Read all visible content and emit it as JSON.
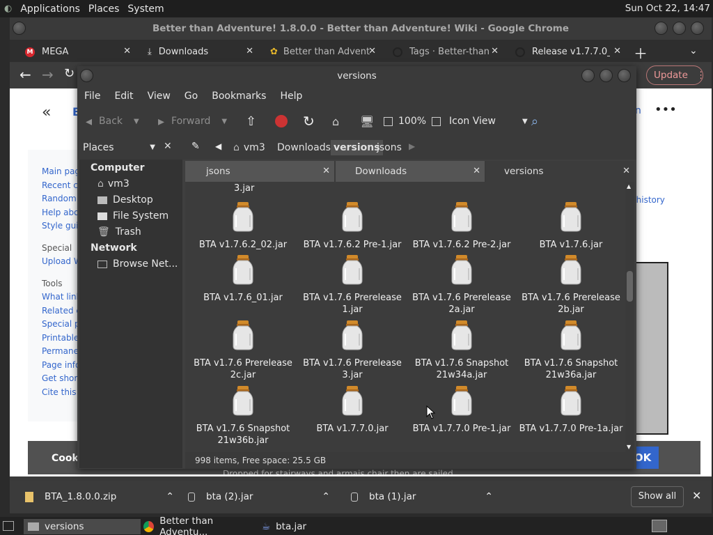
{
  "topbar": {
    "menus": [
      "Applications",
      "Places",
      "System"
    ],
    "clock": "Sun Oct 22, 14:47"
  },
  "chrome": {
    "title": "Better than Adventure! 1.8.0.0 - Better than Adventure! Wiki - Google Chrome",
    "tabs": [
      {
        "label": "MEGA",
        "icon": "mega-icon"
      },
      {
        "label": "Downloads",
        "icon": "download-icon"
      },
      {
        "label": "Better than Advent",
        "icon": "bta-icon"
      },
      {
        "label": "Tags · Better-than-",
        "icon": "github-icon"
      },
      {
        "label": "Release v1.7.7.0_0",
        "icon": "github-icon"
      }
    ],
    "update_label": "Update"
  },
  "wiki": {
    "logo_partial": "B",
    "sidebar_links_1": [
      "Main page",
      "Recent ch",
      "Random",
      "Help abou",
      "Style guid"
    ],
    "special_head": "Special",
    "special_links": [
      "Upload W"
    ],
    "tools_head": "Tools",
    "tools_links": [
      "What link",
      "Related c",
      "Special pa",
      "Printable",
      "Permane",
      "Page info",
      "Get short",
      "Cite this p"
    ],
    "history_link": "w history",
    "right_partial": "n",
    "cookie_partial": "Cook",
    "ok_label": "OK",
    "bottom_text": "Dropped for stairways and armais chair then are sailed"
  },
  "downloads": {
    "items": [
      {
        "name": "BTA_1.8.0.0.zip"
      },
      {
        "name": "bta (2).jar"
      },
      {
        "name": "bta (1).jar"
      }
    ],
    "show_all": "Show all"
  },
  "filemanager": {
    "title": "versions",
    "menu": [
      "File",
      "Edit",
      "View",
      "Go",
      "Bookmarks",
      "Help"
    ],
    "toolbar": {
      "back": "Back",
      "forward": "Forward",
      "zoom": "100%",
      "view_mode": "Icon View"
    },
    "places_label": "Places",
    "breadcrumbs": [
      "vm3",
      "Downloads",
      "versions",
      "jsons"
    ],
    "side": {
      "computer": "Computer",
      "computer_items": [
        "vm3",
        "Desktop",
        "File System",
        "Trash"
      ],
      "network": "Network",
      "network_items": [
        "Browse Net..."
      ]
    },
    "tabs": [
      "jsons",
      "Downloads",
      "versions"
    ],
    "partial_top": "3.jar",
    "files": [
      "BTA v1.7.6.2_02.jar",
      "BTA v1.7.6.2 Pre-1.jar",
      "BTA v1.7.6.2 Pre-2.jar",
      "BTA v1.7.6.jar",
      "BTA v1.7.6_01.jar",
      "BTA v1.7.6 Prerelease 1.jar",
      "BTA v1.7.6 Prerelease 2a.jar",
      "BTA v1.7.6 Prerelease 2b.jar",
      "BTA v1.7.6 Prerelease 2c.jar",
      "BTA v1.7.6 Prerelease 3.jar",
      "BTA v1.7.6 Snapshot 21w34a.jar",
      "BTA v1.7.6 Snapshot 21w36a.jar",
      "BTA v1.7.6 Snapshot 21w36b.jar",
      "BTA v1.7.7.0.jar",
      "BTA v1.7.7.0 Pre-1.jar",
      "BTA v1.7.7.0 Pre-1a.jar"
    ],
    "status": "998 items, Free space: 25.5 GB"
  },
  "taskbar": {
    "items": [
      "versions",
      "Better than Adventu...",
      "bta.jar"
    ]
  }
}
